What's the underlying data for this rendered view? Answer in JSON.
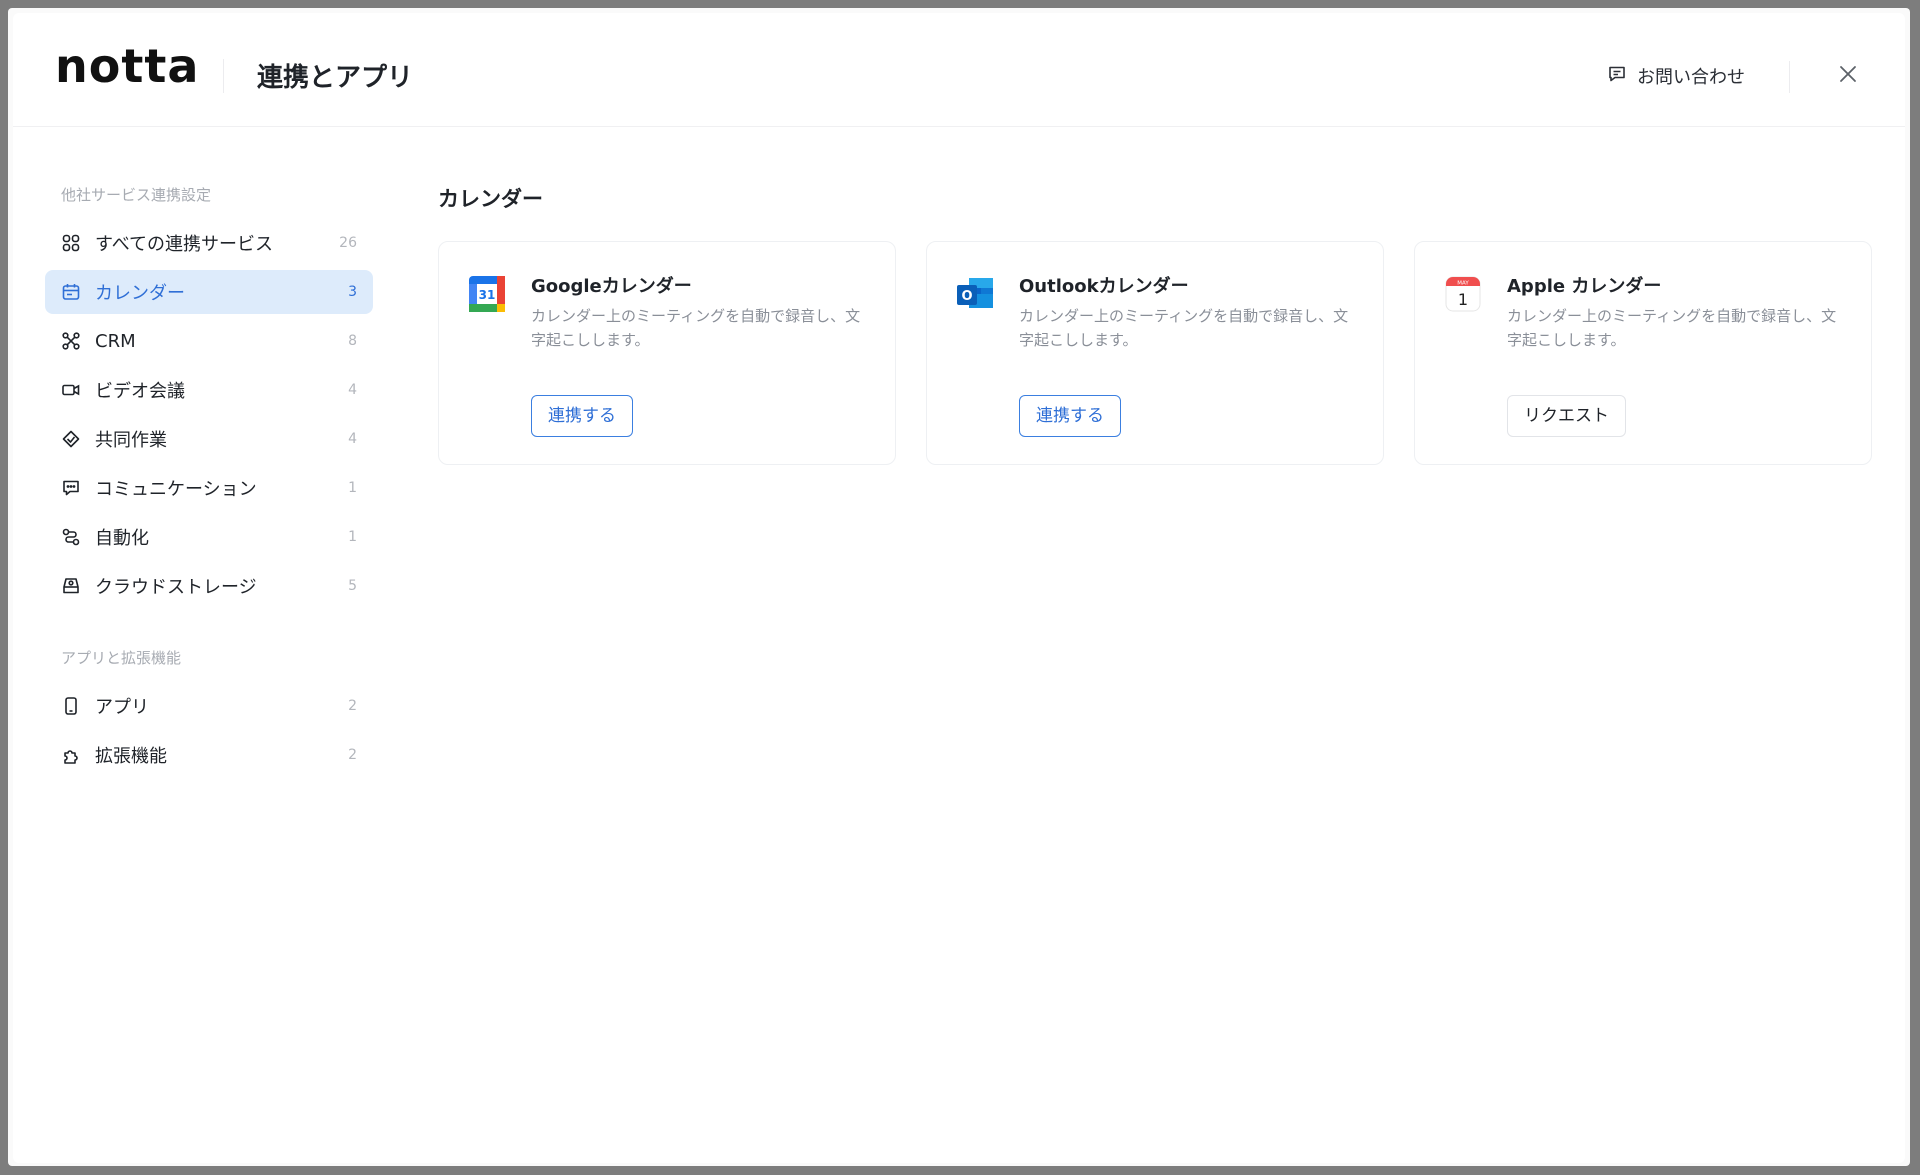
{
  "header": {
    "logo_text": "notta",
    "title": "連携とアプリ",
    "contact_label": "お問い合わせ"
  },
  "sidebar": {
    "section1_label": "他社サービス連携設定",
    "section2_label": "アプリと拡張機能",
    "items": [
      {
        "label": "すべての連携サービス",
        "count": "26",
        "icon": "grid-icon"
      },
      {
        "label": "カレンダー",
        "count": "3",
        "icon": "calendar-icon",
        "active": true
      },
      {
        "label": "CRM",
        "count": "8",
        "icon": "crm-icon"
      },
      {
        "label": "ビデオ会議",
        "count": "4",
        "icon": "video-icon"
      },
      {
        "label": "共同作業",
        "count": "4",
        "icon": "handshake-icon"
      },
      {
        "label": "コミュニケーション",
        "count": "1",
        "icon": "chat-icon"
      },
      {
        "label": "自動化",
        "count": "1",
        "icon": "automation-icon"
      },
      {
        "label": "クラウドストレージ",
        "count": "5",
        "icon": "storage-icon"
      }
    ],
    "items2": [
      {
        "label": "アプリ",
        "count": "2",
        "icon": "phone-icon"
      },
      {
        "label": "拡張機能",
        "count": "2",
        "icon": "puzzle-icon"
      }
    ]
  },
  "main": {
    "title": "カレンダー",
    "cards": [
      {
        "name": "Googleカレンダー",
        "description": "カレンダー上のミーティングを自動で録音し、文字起こしします。",
        "button": "連携する",
        "logo": "google-calendar-icon",
        "logo_text": "31"
      },
      {
        "name": "Outlookカレンダー",
        "description": "カレンダー上のミーティングを自動で録音し、文字起こしします。",
        "button": "連携する",
        "logo": "outlook-icon",
        "logo_text": "O"
      },
      {
        "name": "Apple カレンダー",
        "description": "カレンダー上のミーティングを自動で録音し、文字起こしします。",
        "button": "リクエスト",
        "logo": "apple-calendar-icon",
        "logo_text": "1",
        "logo_month": "MAY"
      }
    ]
  },
  "colors": {
    "accent": "#2f6fd6",
    "active_bg": "#ddebfb",
    "text": "#1f2329",
    "muted": "#8a8f98"
  }
}
